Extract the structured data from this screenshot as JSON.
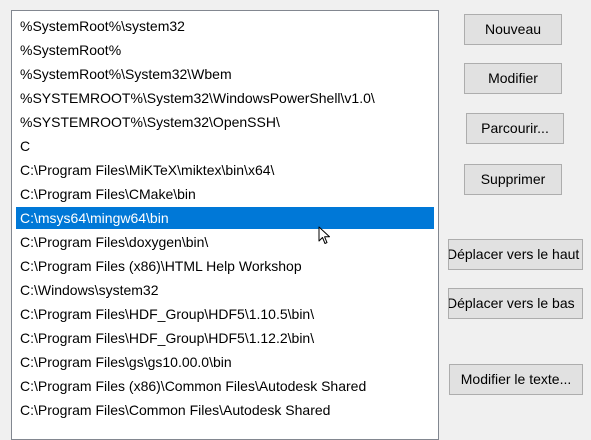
{
  "path_list": {
    "items": [
      "%SystemRoot%\\system32",
      "%SystemRoot%",
      "%SystemRoot%\\System32\\Wbem",
      "%SYSTEMROOT%\\System32\\WindowsPowerShell\\v1.0\\",
      "%SYSTEMROOT%\\System32\\OpenSSH\\",
      "C",
      "C:\\Program Files\\MiKTeX\\miktex\\bin\\x64\\",
      "C:\\Program Files\\CMake\\bin",
      "C:\\msys64\\mingw64\\bin",
      "C:\\Program Files\\doxygen\\bin\\",
      "C:\\Program Files (x86)\\HTML Help Workshop",
      "C:\\Windows\\system32",
      "C:\\Program Files\\HDF_Group\\HDF5\\1.10.5\\bin\\",
      "C:\\Program Files\\HDF_Group\\HDF5\\1.12.2\\bin\\",
      "C:\\Program Files\\gs\\gs10.00.0\\bin",
      "C:\\Program Files (x86)\\Common Files\\Autodesk Shared",
      "C:\\Program Files\\Common Files\\Autodesk Shared"
    ],
    "selected_index": 8
  },
  "buttons": {
    "new_label": "Nouveau",
    "edit_label": "Modifier",
    "browse_label": "Parcourir...",
    "delete_label": "Supprimer",
    "move_up_label": "Déplacer vers le haut",
    "move_down_label": "Déplacer vers le bas",
    "edit_text_label": "Modifier le texte..."
  },
  "colors": {
    "selection": "#0078d7",
    "window_bg": "#f0f0f0",
    "button_bg": "#e1e1e1",
    "button_border": "#adadad",
    "list_border": "#828790"
  }
}
